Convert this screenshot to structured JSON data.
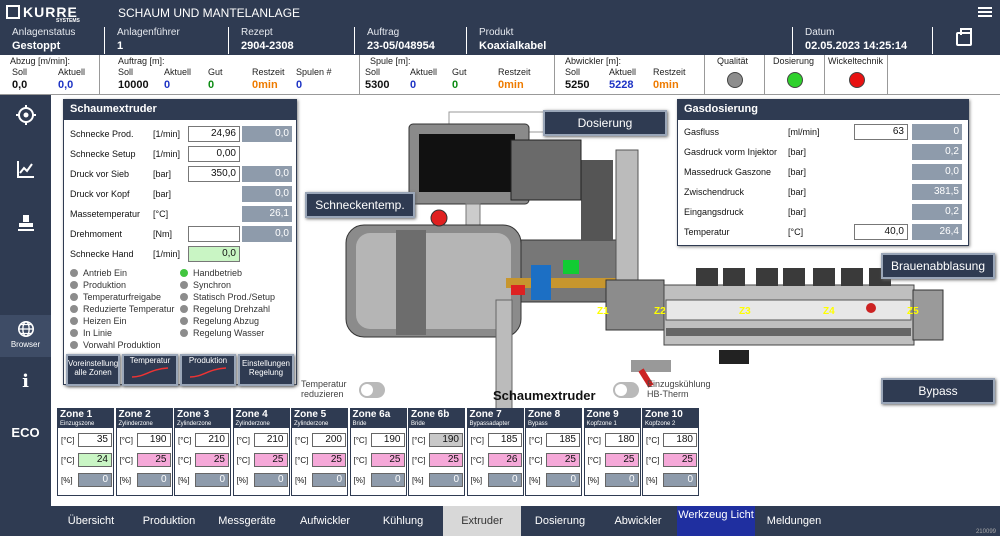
{
  "header": {
    "logo": "KURRE",
    "logo_sub": "SYSTEMS",
    "title": "SCHAUM UND MANTELANLAGE"
  },
  "info": [
    {
      "label": "Anlagenstatus",
      "value": "Gestoppt"
    },
    {
      "label": "Anlagenführer",
      "value": "1"
    },
    {
      "label": "Rezept",
      "value": "2904-2308"
    },
    {
      "label": "Auftrag",
      "value": "23-05/048954"
    },
    {
      "label": "Produkt",
      "value": "Koaxialkabel"
    },
    {
      "label": "Datum",
      "value": "02.05.2023 14:25:14"
    }
  ],
  "kpi": {
    "abzug": {
      "title": "Abzug [m/min]:",
      "soll_l": "Soll",
      "soll": "0,0",
      "akt_l": "Aktuell",
      "akt": "0,0"
    },
    "auftrag": {
      "title": "Auftrag [m]:",
      "soll_l": "Soll",
      "soll": "10000",
      "akt_l": "Aktuell",
      "akt": "0",
      "gut_l": "Gut",
      "gut": "0",
      "rest_l": "Restzeit",
      "rest": "0min",
      "spulen_l": "Spulen #",
      "spulen": "0"
    },
    "spule": {
      "title": "Spule [m]:",
      "soll_l": "Soll",
      "soll": "5300",
      "akt_l": "Aktuell",
      "akt": "0",
      "gut_l": "Gut",
      "gut": "0",
      "rest_l": "Restzeit",
      "rest": "0min"
    },
    "abwickler": {
      "title": "Abwickler [m]:",
      "soll_l": "Soll",
      "soll": "5250",
      "akt_l": "Aktuell",
      "akt": "5228",
      "rest_l": "Restzeit",
      "rest": "0min"
    },
    "lamps": [
      {
        "label": "Qualität",
        "color": "#8d8d8d"
      },
      {
        "label": "Dosierung",
        "color": "#2fd12c"
      },
      {
        "label": "Wickeltechnik",
        "color": "#e81212"
      }
    ]
  },
  "sidebar": {
    "browser": "Browser",
    "eco": "ECO"
  },
  "schaum": {
    "title": "Schaumextruder",
    "rows": [
      {
        "name": "Schnecke Prod.",
        "unit": "[1/min]",
        "input": "24,96",
        "ro": "0,0"
      },
      {
        "name": "Schnecke Setup",
        "unit": "[1/min]",
        "input": "0,00",
        "ro": ""
      },
      {
        "name": "Druck vor Sieb",
        "unit": "[bar]",
        "input": "350,0",
        "ro": "0,0"
      },
      {
        "name": "Druck vor Kopf",
        "unit": "[bar]",
        "input": "",
        "ro": "0,0"
      },
      {
        "name": "Massetemperatur",
        "unit": "[°C]",
        "input": "",
        "ro": "26,1"
      },
      {
        "name": "Drehmoment",
        "unit": "[Nm]",
        "input": "",
        "ro": "0,0"
      },
      {
        "name": "Schnecke Hand",
        "unit": "[1/min]",
        "input": "0,0",
        "ro": ""
      }
    ],
    "leds_left": [
      {
        "t": "Antrieb Ein",
        "on": false
      },
      {
        "t": "Produktion",
        "on": false
      },
      {
        "t": "Temperaturfreigabe",
        "on": false
      },
      {
        "t": "Reduzierte Temperatur",
        "on": false
      },
      {
        "t": "Heizen Ein",
        "on": false
      },
      {
        "t": "In Linie",
        "on": false
      },
      {
        "t": "Vorwahl Produktion",
        "on": false
      }
    ],
    "leds_right": [
      {
        "t": "Handbetrieb",
        "on": true
      },
      {
        "t": "Synchron",
        "on": false
      },
      {
        "t": "Statisch Prod./Setup",
        "on": false
      },
      {
        "t": "Regelung Drehzahl",
        "on": false
      },
      {
        "t": "Regelung Abzug",
        "on": false
      },
      {
        "t": "Regelung Wasser",
        "on": false
      }
    ],
    "buttons": [
      "Voreinstellung alle Zonen",
      "Temperatur",
      "Produktion",
      "Einstellungen Regelung"
    ]
  },
  "gas": {
    "title": "Gasdosierung",
    "rows": [
      {
        "name": "Gasfluss",
        "unit": "[ml/min]",
        "input": "63",
        "ro": "0"
      },
      {
        "name": "Gasdruck vorm Injektor",
        "unit": "[bar]",
        "input": "",
        "ro": "0,2"
      },
      {
        "name": "Massedruck Gaszone",
        "unit": "[bar]",
        "input": "",
        "ro": "0,0"
      },
      {
        "name": "Zwischendruck",
        "unit": "[bar]",
        "input": "",
        "ro": "381,5"
      },
      {
        "name": "Eingangsdruck",
        "unit": "[bar]",
        "input": "",
        "ro": "0,2"
      },
      {
        "name": "Temperatur",
        "unit": "[°C]",
        "input": "40,0",
        "ro": "26,4"
      }
    ]
  },
  "machine": {
    "dosierung": "Dosierung",
    "schneckentemp": "Schneckentemp.",
    "brauen": "Brauenabblasung",
    "bypass": "Bypass",
    "label": "Schaumextruder",
    "t1": "Temperatur reduzieren",
    "t2": "Einzugskühlung HB-Therm",
    "zones": [
      "Z1",
      "Z2",
      "Z3",
      "Z4",
      "Z5"
    ]
  },
  "zones": [
    {
      "n": "Zone 1",
      "s": "Einzugszone",
      "v1": "35",
      "v2": "24",
      "v3": "0",
      "hl": "green"
    },
    {
      "n": "Zone 2",
      "s": "Zylinderzone",
      "v1": "190",
      "v2": "25",
      "v3": "0",
      "hl": "pink"
    },
    {
      "n": "Zone 3",
      "s": "Zylinderzone",
      "v1": "210",
      "v2": "25",
      "v3": "0",
      "hl": "pink"
    },
    {
      "n": "Zone 4",
      "s": "Zylinderzone",
      "v1": "210",
      "v2": "25",
      "v3": "0",
      "hl": "pink"
    },
    {
      "n": "Zone 5",
      "s": "Zylinderzone",
      "v1": "200",
      "v2": "25",
      "v3": "0",
      "hl": "pink"
    },
    {
      "n": "Zone 6a",
      "s": "Bride",
      "v1": "190",
      "v2": "25",
      "v3": "0",
      "hl": "pink"
    },
    {
      "n": "Zone 6b",
      "s": "Bride",
      "v1": "190",
      "v2": "25",
      "v3": "0",
      "hl": "pink",
      "grey": true
    },
    {
      "n": "Zone 7",
      "s": "Bypassadapter",
      "v1": "185",
      "v2": "26",
      "v3": "0",
      "hl": "pink"
    },
    {
      "n": "Zone 8",
      "s": "Bypass",
      "v1": "185",
      "v2": "25",
      "v3": "0",
      "hl": "pink"
    },
    {
      "n": "Zone 9",
      "s": "Kopfzone 1",
      "v1": "180",
      "v2": "25",
      "v3": "0",
      "hl": "pink"
    },
    {
      "n": "Zone 10",
      "s": "Kopfzone 2",
      "v1": "180",
      "v2": "25",
      "v3": "0",
      "hl": "pink"
    }
  ],
  "zone_units": [
    "[°C]",
    "[°C]",
    "[%]"
  ],
  "nav": [
    "Übersicht",
    "Produktion",
    "Messgeräte",
    "Aufwickler",
    "Kühlung",
    "Extruder",
    "Dosierung",
    "Abwickler",
    "Werkzeug Licht",
    "Meldungen"
  ],
  "version": "210099"
}
